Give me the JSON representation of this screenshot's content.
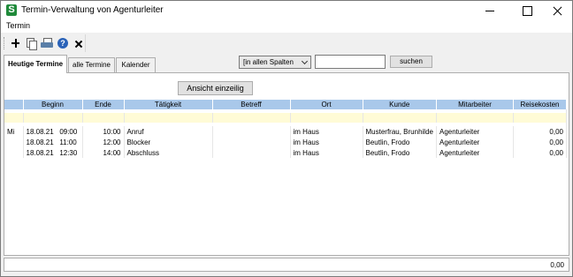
{
  "window": {
    "app_icon_letter": "S",
    "title": "Termin-Verwaltung von  Agenturleiter"
  },
  "menu": {
    "items": [
      "Termin"
    ]
  },
  "toolbar": {
    "icons": [
      "add-icon",
      "copy-icon",
      "print-icon",
      "help-icon",
      "delete-icon"
    ],
    "help_glyph": "?"
  },
  "tabs": [
    {
      "label": "Heutige Termine",
      "active": true
    },
    {
      "label": "alle Termine",
      "active": false
    },
    {
      "label": "Kalender",
      "active": false
    }
  ],
  "search": {
    "column_filter": "[in allen Spalten",
    "query": "",
    "button_label": "suchen"
  },
  "view_button_label": "Ansicht einzeilig",
  "table": {
    "headers": [
      "",
      "Beginn",
      "Ende",
      "Tätigkeit",
      "Betreff",
      "Ort",
      "Kunde",
      "Mitarbeiter",
      "Reisekosten"
    ],
    "rows": [
      {
        "day": "Mi",
        "date": "18.08.21",
        "start": "09:00",
        "end": "10:00",
        "activity": "Anruf",
        "subject": "",
        "place": "im Haus",
        "customer": "Musterfrau, Brunhilde",
        "employee": "Agenturleiter",
        "costs": "0,00"
      },
      {
        "day": "",
        "date": "18.08.21",
        "start": "11:00",
        "end": "12:00",
        "activity": "Blocker",
        "subject": "",
        "place": "im Haus",
        "customer": "Beutlin, Frodo",
        "employee": "Agenturleiter",
        "costs": "0,00"
      },
      {
        "day": "",
        "date": "18.08.21",
        "start": "12:30",
        "end": "14:00",
        "activity": "Abschluss",
        "subject": "",
        "place": "im Haus",
        "customer": "Beutlin, Frodo",
        "employee": "Agenturleiter",
        "costs": "0,00"
      }
    ]
  },
  "status": {
    "total": "0,00"
  },
  "colors": {
    "header_bg": "#a9c8ea",
    "filter_row_bg": "#fffbd6",
    "app_icon": "#1f8a3a"
  }
}
